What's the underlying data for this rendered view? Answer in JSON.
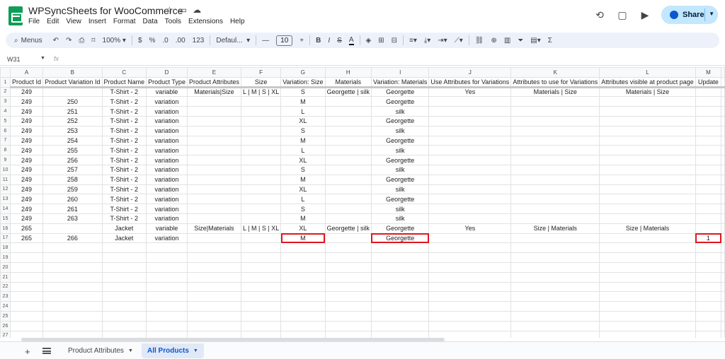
{
  "app": {
    "title": "WPSyncSheets for WooCommerce",
    "menu": [
      "File",
      "Edit",
      "View",
      "Insert",
      "Format",
      "Data",
      "Tools",
      "Extensions",
      "Help"
    ],
    "share_label": "Share"
  },
  "toolbar": {
    "menus_label": "Menus",
    "zoom": "100%",
    "currency": "$",
    "percent": "%",
    "dec_decrease": ".0",
    "dec_increase": ".00",
    "number_format": "123",
    "font": "Defaul...",
    "font_size": "10",
    "minus": "—",
    "plus": "+",
    "bold": "B",
    "italic": "I",
    "strike": "S",
    "text_color": "A",
    "sigma": "Σ"
  },
  "formula_bar": {
    "cell_ref": "W31",
    "fx": "fx",
    "value": ""
  },
  "grid": {
    "columns": [
      "A",
      "B",
      "C",
      "D",
      "E",
      "F",
      "G",
      "H",
      "I",
      "J",
      "K",
      "L",
      "M"
    ],
    "header": [
      "Product Id",
      "Product Variation Id",
      "Product Name",
      "Product Type",
      "Product Attributes",
      "Size",
      "Variation: Size",
      "Materials",
      "Variation: Materials",
      "Use Attributes for Variations",
      "Attributes to use for Variations",
      "Attributes visible at product page",
      "Update"
    ],
    "rows": [
      [
        "249",
        "",
        "T-Shirt - 2",
        "variable",
        "Materials|Size",
        "L | M | S | XL",
        "S",
        "Georgette | silk",
        "Georgette",
        "Yes",
        "Materials | Size",
        "Materials | Size",
        ""
      ],
      [
        "249",
        "250",
        "T-Shirt - 2",
        "variation",
        "",
        "",
        "M",
        "",
        "Georgette",
        "",
        "",
        "",
        ""
      ],
      [
        "249",
        "251",
        "T-Shirt - 2",
        "variation",
        "",
        "",
        "L",
        "",
        "silk",
        "",
        "",
        "",
        ""
      ],
      [
        "249",
        "252",
        "T-Shirt - 2",
        "variation",
        "",
        "",
        "XL",
        "",
        "Georgette",
        "",
        "",
        "",
        ""
      ],
      [
        "249",
        "253",
        "T-Shirt - 2",
        "variation",
        "",
        "",
        "S",
        "",
        "silk",
        "",
        "",
        "",
        ""
      ],
      [
        "249",
        "254",
        "T-Shirt - 2",
        "variation",
        "",
        "",
        "M",
        "",
        "Georgette",
        "",
        "",
        "",
        ""
      ],
      [
        "249",
        "255",
        "T-Shirt - 2",
        "variation",
        "",
        "",
        "L",
        "",
        "silk",
        "",
        "",
        "",
        ""
      ],
      [
        "249",
        "256",
        "T-Shirt - 2",
        "variation",
        "",
        "",
        "XL",
        "",
        "Georgette",
        "",
        "",
        "",
        ""
      ],
      [
        "249",
        "257",
        "T-Shirt - 2",
        "variation",
        "",
        "",
        "S",
        "",
        "silk",
        "",
        "",
        "",
        ""
      ],
      [
        "249",
        "258",
        "T-Shirt - 2",
        "variation",
        "",
        "",
        "M",
        "",
        "Georgette",
        "",
        "",
        "",
        ""
      ],
      [
        "249",
        "259",
        "T-Shirt - 2",
        "variation",
        "",
        "",
        "XL",
        "",
        "silk",
        "",
        "",
        "",
        ""
      ],
      [
        "249",
        "260",
        "T-Shirt - 2",
        "variation",
        "",
        "",
        "L",
        "",
        "Georgette",
        "",
        "",
        "",
        ""
      ],
      [
        "249",
        "261",
        "T-Shirt - 2",
        "variation",
        "",
        "",
        "S",
        "",
        "silk",
        "",
        "",
        "",
        ""
      ],
      [
        "249",
        "263",
        "T-Shirt - 2",
        "variation",
        "",
        "",
        "M",
        "",
        "silk",
        "",
        "",
        "",
        ""
      ],
      [
        "265",
        "",
        "Jacket",
        "variable",
        "Size|Materials",
        "L | M | S | XL",
        "XL",
        "Georgette | silk",
        "Georgette",
        "Yes",
        "Size | Materials",
        "Size | Materials",
        ""
      ],
      [
        "265",
        "266",
        "Jacket",
        "variation",
        "",
        "",
        "M",
        "",
        "Georgette",
        "",
        "",
        "",
        "1"
      ]
    ],
    "highlight_color": "#e0161f",
    "highlighted_cells": [
      [
        15,
        6
      ],
      [
        15,
        8
      ],
      [
        15,
        12
      ]
    ],
    "total_rows": 27
  },
  "tabs": [
    {
      "label": "Product Attributes",
      "active": false
    },
    {
      "label": "All Products",
      "active": true
    }
  ]
}
